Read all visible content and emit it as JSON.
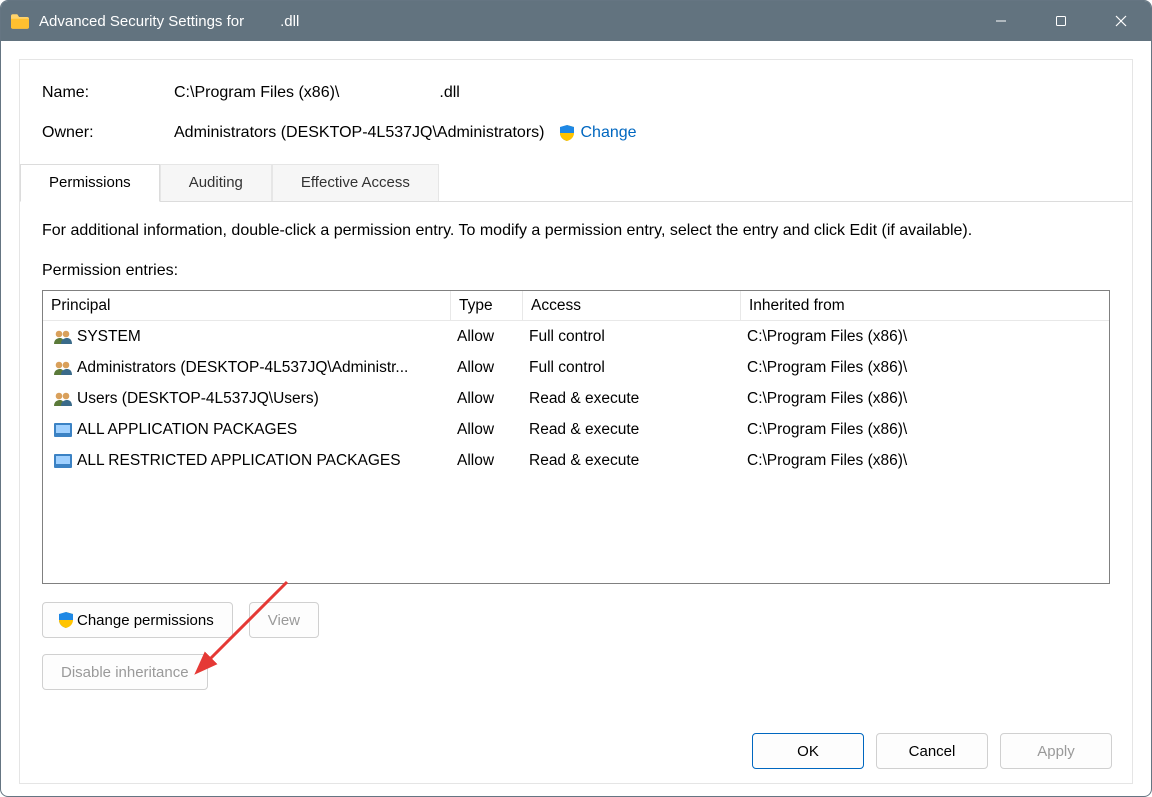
{
  "title_prefix": "Advanced Security Settings for",
  "title_suffix": ".dll",
  "info": {
    "name_label": "Name:",
    "name_value_prefix": "C:\\Program Files (x86)\\",
    "name_value_suffix": ".dll",
    "owner_label": "Owner:",
    "owner_value": "Administrators (DESKTOP-4L537JQ\\Administrators)",
    "change_label": "Change"
  },
  "tabs": {
    "permissions": "Permissions",
    "auditing": "Auditing",
    "effective": "Effective Access"
  },
  "hint": "For additional information, double-click a permission entry. To modify a permission entry, select the entry and click Edit (if available).",
  "entries_label": "Permission entries:",
  "columns": {
    "principal": "Principal",
    "type": "Type",
    "access": "Access",
    "inherited": "Inherited from"
  },
  "rows": [
    {
      "icon": "users",
      "principal": "SYSTEM",
      "type": "Allow",
      "access": "Full control",
      "inherited": "C:\\Program Files (x86)\\"
    },
    {
      "icon": "users",
      "principal": "Administrators (DESKTOP-4L537JQ\\Administr...",
      "type": "Allow",
      "access": "Full control",
      "inherited": "C:\\Program Files (x86)\\"
    },
    {
      "icon": "users",
      "principal": "Users (DESKTOP-4L537JQ\\Users)",
      "type": "Allow",
      "access": "Read & execute",
      "inherited": "C:\\Program Files (x86)\\"
    },
    {
      "icon": "package",
      "principal": "ALL APPLICATION PACKAGES",
      "type": "Allow",
      "access": "Read & execute",
      "inherited": "C:\\Program Files (x86)\\"
    },
    {
      "icon": "package",
      "principal": "ALL RESTRICTED APPLICATION PACKAGES",
      "type": "Allow",
      "access": "Read & execute",
      "inherited": "C:\\Program Files (x86)\\"
    }
  ],
  "buttons": {
    "change_perm": "Change permissions",
    "view": "View",
    "disable_inherit": "Disable inheritance",
    "ok": "OK",
    "cancel": "Cancel",
    "apply": "Apply"
  }
}
